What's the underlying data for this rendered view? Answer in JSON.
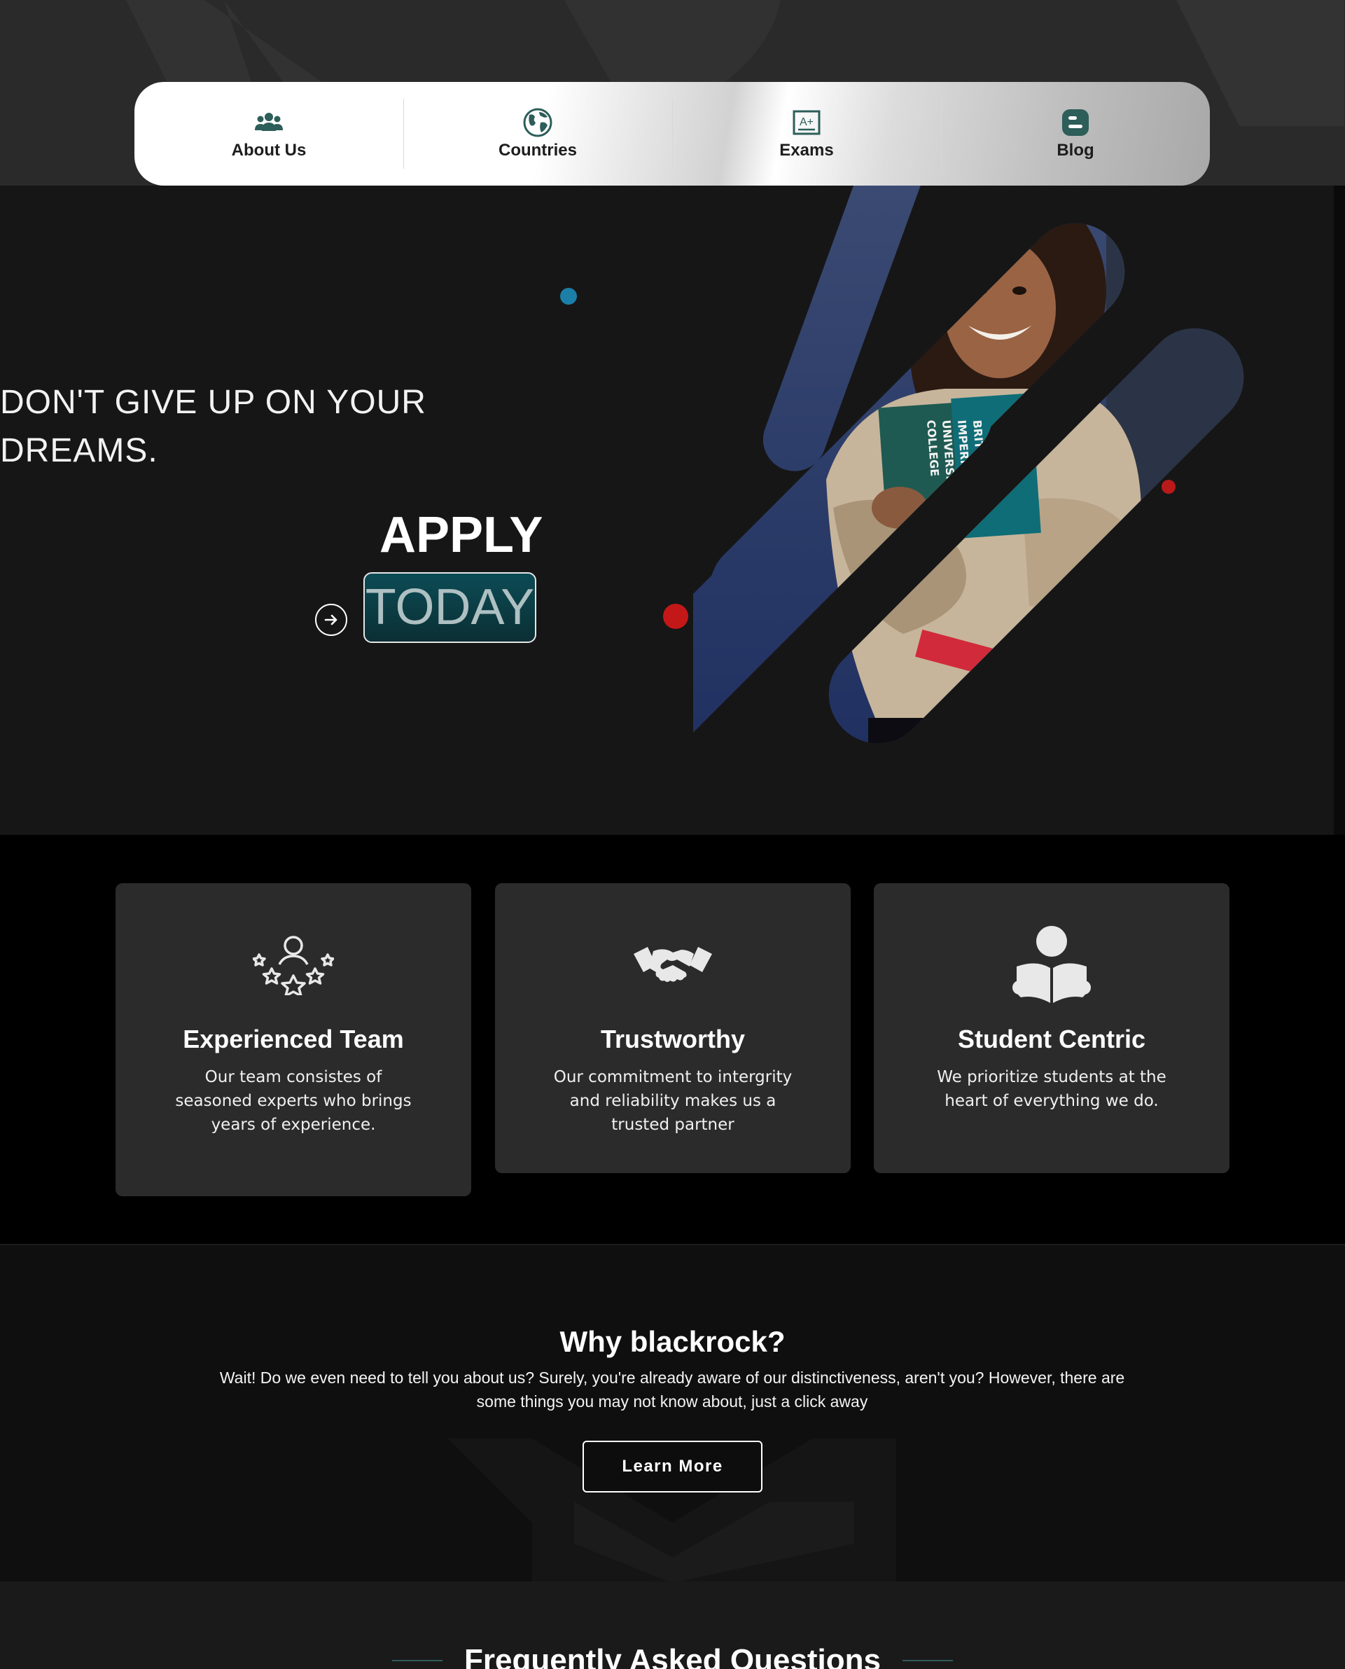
{
  "nav": {
    "items": [
      {
        "label": "About Us",
        "icon": "team-icon"
      },
      {
        "label": "Countries",
        "icon": "globe-icon"
      },
      {
        "label": "Exams",
        "icon": "exam-grade-icon"
      },
      {
        "label": "Blog",
        "icon": "blog-icon"
      }
    ]
  },
  "hero": {
    "title_line1": "DON'T GIVE UP ON YOUR",
    "title_line2": "DREAMS.",
    "apply": "APPLY",
    "today": "TODAY",
    "book_text": "BRITTS IMPERIAL UNIVERSITY COLLEGE"
  },
  "features": [
    {
      "title": "Experienced Team",
      "text": "Our team consistes of seasoned experts who brings years of experience.",
      "icon": "team-stars-icon"
    },
    {
      "title": "Trustworthy",
      "text": "Our commitment to intergrity and reliability makes us a trusted partner",
      "icon": "handshake-icon"
    },
    {
      "title": "Student Centric",
      "text": "We prioritize students at the heart of everything we do.",
      "icon": "student-reading-icon"
    }
  ],
  "why": {
    "title": "Why blackrock?",
    "text": "Wait! Do we even need to tell you about us? Surely, you're already aware of our distinctiveness, aren't you? However, there are some things you may not know about, just a click away",
    "button": "Learn More"
  },
  "faq": {
    "title": "Frequently Asked Questions"
  },
  "colors": {
    "accent": "#2d5e59",
    "teal_button": "#0c4b55",
    "dot_blue": "#1b7fa8",
    "dot_red": "#c41818",
    "card_bg": "#2b2b2b"
  }
}
